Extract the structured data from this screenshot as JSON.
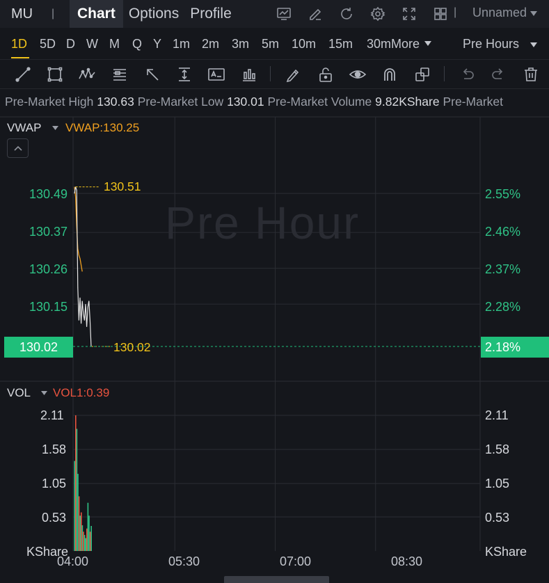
{
  "nav": {
    "ticker": "MU",
    "separator": "|",
    "tabs": [
      {
        "label": "Chart",
        "active": true
      },
      {
        "label": "Options",
        "active": false
      },
      {
        "label": "Profile",
        "active": false
      }
    ],
    "icons": [
      "chart-display-icon",
      "pencil-icon",
      "refresh-icon",
      "settings-gear-icon",
      "fullscreen-icon",
      "grid-layout-icon"
    ],
    "layout_name": "Unnamed"
  },
  "timeframes": {
    "items": [
      "1D",
      "5D",
      "D",
      "W",
      "M",
      "Q",
      "Y",
      "1m",
      "2m",
      "3m",
      "5m",
      "10m",
      "15m",
      "30m"
    ],
    "active": "1D",
    "more_label": "More",
    "session_label": "Pre Hours"
  },
  "toolbar": {
    "tools": [
      "trend-line-icon",
      "rectangle-icon",
      "pattern-icon",
      "fibonacci-icon",
      "arrow-icon",
      "measure-icon",
      "text-note-icon",
      "indicators-icon",
      "brush-icon",
      "lock-icon",
      "eye-icon",
      "magnet-icon",
      "layers-icon",
      "undo-icon",
      "redo-icon",
      "trash-icon"
    ]
  },
  "info": {
    "items": [
      {
        "label": "Pre-Market High",
        "value": "130.63"
      },
      {
        "label": "Pre-Market Low",
        "value": "130.01"
      },
      {
        "label": "Pre-Market Volume",
        "value": "9.82KShare"
      },
      {
        "label": "Pre-Market",
        "value": ""
      }
    ]
  },
  "price_panel": {
    "indicator": "VWAP",
    "indicator_value": "VWAP:130.25",
    "watermark": "Pre Hour",
    "left_ticks": [
      "130.49",
      "130.37",
      "130.26",
      "130.15"
    ],
    "right_ticks": [
      "2.55%",
      "2.46%",
      "2.37%",
      "2.28%"
    ],
    "current_price": "130.02",
    "current_pct": "2.18%",
    "high_label": "130.51",
    "last_label": "130.02"
  },
  "volume_panel": {
    "indicator": "VOL",
    "indicator_value": "VOL1:0.39",
    "left_ticks": [
      "2.11",
      "1.58",
      "1.05",
      "0.53"
    ],
    "right_ticks": [
      "2.11",
      "1.58",
      "1.05",
      "0.53"
    ],
    "unit_left": "KShare",
    "unit_right": "KShare"
  },
  "x_axis": {
    "ticks": [
      "04:00",
      "05:30",
      "07:00",
      "08:30"
    ]
  },
  "colors": {
    "up": "#2fc286",
    "down": "#e8533f",
    "vwap": "#f0a020",
    "annotation": "#f0c21a",
    "price_line": "#e6e6e6"
  },
  "chart_data": {
    "type": "line",
    "x_range": [
      "04:00",
      "09:30"
    ],
    "series": [
      {
        "name": "VWAP",
        "x": [
          "04:00",
          "04:01",
          "04:02",
          "04:03",
          "04:04",
          "04:05",
          "04:06",
          "04:07"
        ],
        "values": [
          130.51,
          130.48,
          130.39,
          130.32,
          130.3,
          130.29,
          130.27,
          130.25
        ]
      }
    ],
    "price_x": [
      "04:00",
      "04:01",
      "04:02",
      "04:03",
      "04:04",
      "04:05",
      "04:06",
      "04:07",
      "04:08",
      "04:09",
      "04:10",
      "04:11",
      "04:12",
      "04:13",
      "04:14",
      "04:15"
    ],
    "price_values": [
      130.49,
      130.51,
      130.5,
      130.2,
      130.1,
      130.17,
      130.09,
      130.16,
      130.12,
      130.1,
      130.15,
      130.08,
      130.14,
      130.16,
      130.1,
      130.02
    ],
    "volume_values": [
      1.4,
      2.11,
      1.9,
      1.2,
      0.85,
      0.55,
      0.6,
      0.4,
      0.3,
      0.25,
      0.2,
      0.35,
      0.75,
      0.55,
      0.3,
      0.39
    ],
    "volume_up": [
      true,
      false,
      true,
      true,
      false,
      true,
      false,
      true,
      false,
      true,
      true,
      false,
      true,
      true,
      false,
      true
    ],
    "price_ylim": [
      130.0,
      130.56
    ],
    "volume_ylim": [
      0,
      2.4
    ]
  }
}
